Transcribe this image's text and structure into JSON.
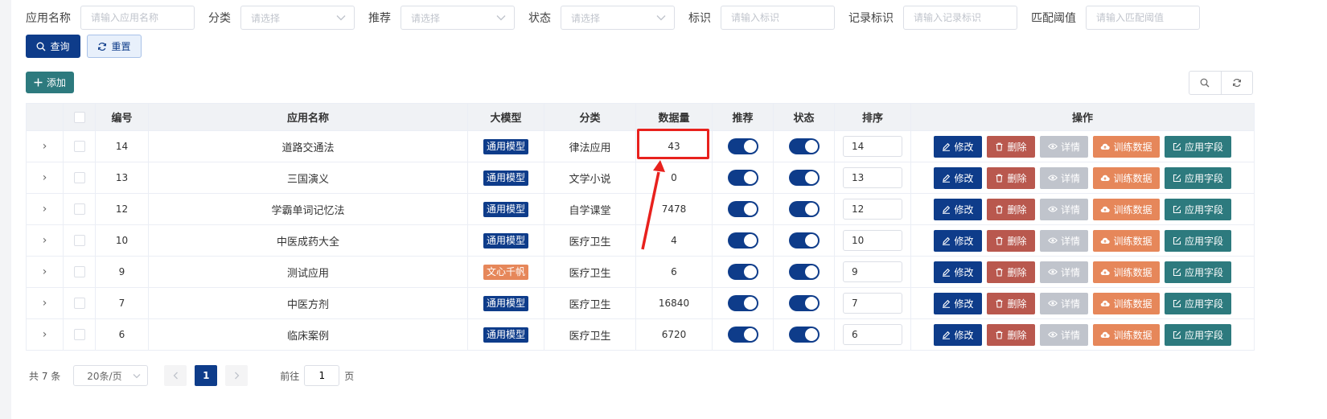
{
  "search": {
    "app_name": {
      "label": "应用名称",
      "placeholder": "请输入应用名称"
    },
    "category": {
      "label": "分类",
      "placeholder": "请选择"
    },
    "recommend": {
      "label": "推荐",
      "placeholder": "请选择"
    },
    "status": {
      "label": "状态",
      "placeholder": "请选择"
    },
    "identifier": {
      "label": "标识",
      "placeholder": "请输入标识"
    },
    "record_identifier": {
      "label": "记录标识",
      "placeholder": "请输入记录标识"
    },
    "match_threshold": {
      "label": "匹配阈值",
      "placeholder": "请输入匹配阈值"
    },
    "query_label": "查询",
    "reset_label": "重置"
  },
  "toolbar": {
    "add_label": "添加"
  },
  "table": {
    "headers": {
      "id": "编号",
      "app_name": "应用名称",
      "model": "大模型",
      "category": "分类",
      "data_count": "数据量",
      "recommend": "推荐",
      "status": "状态",
      "sort": "排序",
      "actions": "操作"
    },
    "actions": {
      "edit": "修改",
      "delete": "删除",
      "detail": "详情",
      "train": "训练数据",
      "fields": "应用字段"
    },
    "rows": [
      {
        "id": "14",
        "name": "道路交通法",
        "model": "通用模型",
        "model_color": "#0e3c8a",
        "category": "律法应用",
        "data_count": "43",
        "recommend": true,
        "status": true,
        "sort": "14"
      },
      {
        "id": "13",
        "name": "三国演义",
        "model": "通用模型",
        "model_color": "#0e3c8a",
        "category": "文学小说",
        "data_count": "0",
        "recommend": true,
        "status": true,
        "sort": "13"
      },
      {
        "id": "12",
        "name": "学霸单词记忆法",
        "model": "通用模型",
        "model_color": "#0e3c8a",
        "category": "自学课堂",
        "data_count": "7478",
        "recommend": true,
        "status": true,
        "sort": "12"
      },
      {
        "id": "10",
        "name": "中医成药大全",
        "model": "通用模型",
        "model_color": "#0e3c8a",
        "category": "医疗卫生",
        "data_count": "4",
        "recommend": true,
        "status": true,
        "sort": "10"
      },
      {
        "id": "9",
        "name": "测试应用",
        "model": "文心千帆",
        "model_color": "#e6875a",
        "category": "医疗卫生",
        "data_count": "6",
        "recommend": true,
        "status": true,
        "sort": "9"
      },
      {
        "id": "7",
        "name": "中医方剂",
        "model": "通用模型",
        "model_color": "#0e3c8a",
        "category": "医疗卫生",
        "data_count": "16840",
        "recommend": true,
        "status": true,
        "sort": "7"
      },
      {
        "id": "6",
        "name": "临床案例",
        "model": "通用模型",
        "model_color": "#0e3c8a",
        "category": "医疗卫生",
        "data_count": "6720",
        "recommend": true,
        "status": true,
        "sort": "6"
      }
    ]
  },
  "pagination": {
    "total": "共 7 条",
    "page_size": "20条/页",
    "current_page": "1",
    "goto_prefix": "前往",
    "goto_value": "1",
    "goto_suffix": "页"
  },
  "colors": {
    "primary": "#0e3c8a",
    "teal": "#2d7a7e",
    "danger": "#b9584e",
    "orange": "#e6875a",
    "disabled": "#c0c4cc",
    "highlight": "#e8211d"
  }
}
